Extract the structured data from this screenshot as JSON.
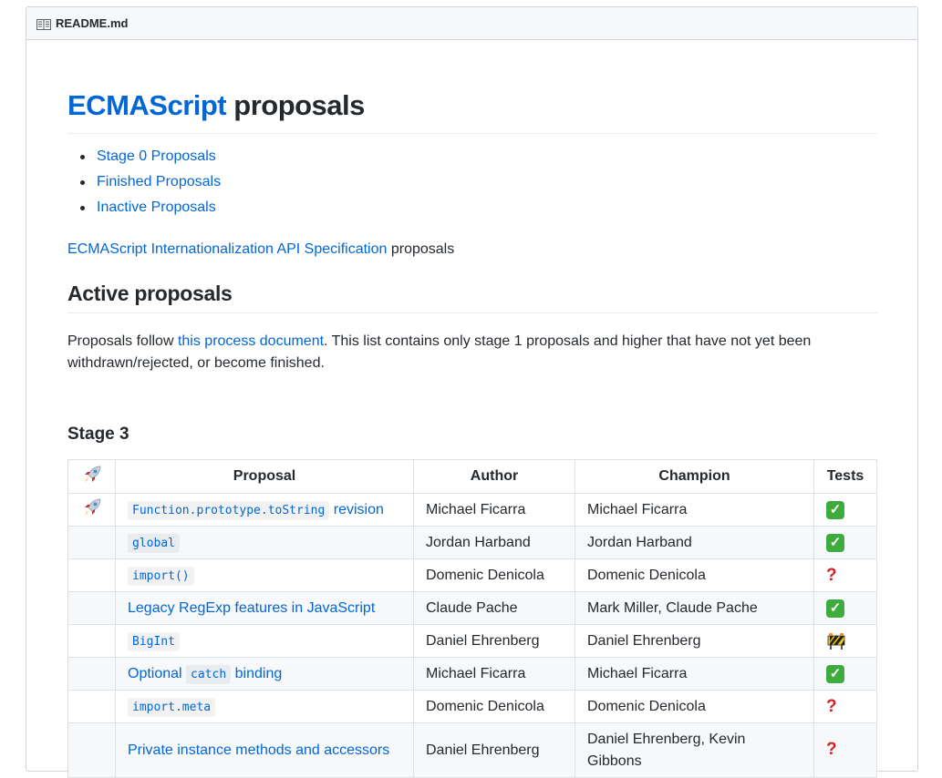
{
  "file": {
    "title": "README.md"
  },
  "heading": {
    "link": "ECMAScript",
    "rest": " proposals"
  },
  "toc": [
    {
      "label": "Stage 0 Proposals"
    },
    {
      "label": "Finished Proposals"
    },
    {
      "label": "Inactive Proposals"
    }
  ],
  "intl": {
    "link": "ECMAScript Internationalization API Specification",
    "rest": " proposals"
  },
  "active": {
    "title": "Active proposals"
  },
  "para": {
    "before": "Proposals follow ",
    "link": "this process document",
    "after": ". This list contains only stage 1 proposals and higher that have not yet been withdrawn/rejected, or become finished."
  },
  "stage3": {
    "title": "Stage 3"
  },
  "table": {
    "headers": {
      "proposal": "Proposal",
      "author": "Author",
      "champion": "Champion",
      "tests": "Tests"
    },
    "rows": [
      {
        "code": "Function.prototype.toString",
        "after": " revision",
        "author": "Michael Ficarra",
        "champion": "Michael Ficarra",
        "tests": "pass"
      },
      {
        "code": "global",
        "author": "Jordan Harband",
        "champion": "Jordan Harband",
        "tests": "pass"
      },
      {
        "code": "import()",
        "author": "Domenic Denicola",
        "champion": "Domenic Denicola",
        "tests": "unknown"
      },
      {
        "text": "Legacy RegExp features in JavaScript",
        "author": "Claude Pache",
        "champion": "Mark Miller, Claude Pache",
        "tests": "pass"
      },
      {
        "code": "BigInt",
        "author": "Daniel Ehrenberg",
        "champion": "Daniel Ehrenberg",
        "tests": "wip"
      },
      {
        "before": "Optional ",
        "code": "catch",
        "after": " binding",
        "author": "Michael Ficarra",
        "champion": "Michael Ficarra",
        "tests": "pass"
      },
      {
        "code": "import.meta",
        "author": "Domenic Denicola",
        "champion": "Domenic Denicola",
        "tests": "unknown"
      },
      {
        "text": "Private instance methods and accessors",
        "author": "Daniel Ehrenberg",
        "champion": "Daniel Ehrenberg, Kevin Gibbons",
        "tests": "unknown"
      }
    ]
  },
  "symbols": {
    "pass": "✓",
    "unknown": "?"
  }
}
